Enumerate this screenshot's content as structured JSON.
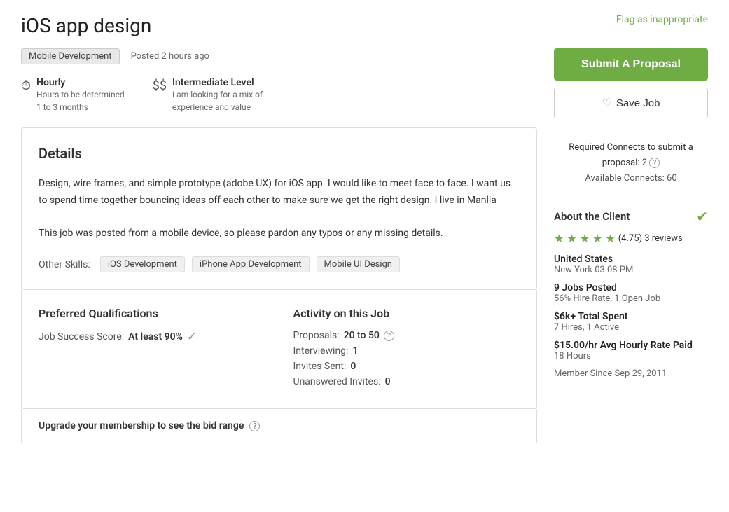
{
  "page": {
    "title": "iOS app design",
    "flag_label": "Flag as inappropriate"
  },
  "meta": {
    "category": "Mobile Development",
    "posted": "Posted 2 hours ago"
  },
  "job_type": {
    "icon": "⏱",
    "label": "Hourly",
    "sub1": "Hours to be determined",
    "sub2": "1 to 3 months"
  },
  "job_level": {
    "icon": "$$",
    "label": "Intermediate Level",
    "sub1": "I am looking for a mix of",
    "sub2": "experience and value"
  },
  "details": {
    "title": "Details",
    "body_para1": "Design, wire frames, and simple prototype (adobe UX) for iOS app. I would like to meet face to face.  I want us to spend time together bouncing ideas off each other to make sure we get the right design.  I live in Manlia",
    "body_para2": "This job was posted from a mobile device, so please pardon any typos or any missing details.",
    "other_skills_label": "Other Skills:",
    "skills": [
      "iOS Development",
      "iPhone App Development",
      "Mobile UI Design"
    ]
  },
  "qualifications": {
    "title": "Preferred Qualifications",
    "job_success_label": "Job Success Score:",
    "job_success_value": "At least 90%"
  },
  "activity": {
    "title": "Activity on this Job",
    "proposals_label": "Proposals:",
    "proposals_value": "20 to 50",
    "interviewing_label": "Interviewing:",
    "interviewing_value": "1",
    "invites_sent_label": "Invites Sent:",
    "invites_sent_value": "0",
    "unanswered_label": "Unanswered Invites:",
    "unanswered_value": "0"
  },
  "upgrade": {
    "text": "Upgrade your membership to see the bid range"
  },
  "sidebar": {
    "submit_label": "Submit A Proposal",
    "save_label": "Save Job",
    "connects_text": "Required Connects to submit a proposal: 2",
    "available_label": "Available Connects: 60",
    "about_title": "About the Client",
    "rating": "4.75",
    "rating_label": "(4.75) 3 reviews",
    "country": "United States",
    "location_time": "New York 03:08 PM",
    "jobs_posted_label": "9 Jobs Posted",
    "hire_rate": "56% Hire Rate, 1 Open Job",
    "total_spent": "$6k+ Total Spent",
    "hires": "7 Hires, 1 Active",
    "avg_rate": "$15.00/hr Avg Hourly Rate Paid",
    "hours": "18 Hours",
    "member_since": "Member Since Sep 29, 2011"
  }
}
